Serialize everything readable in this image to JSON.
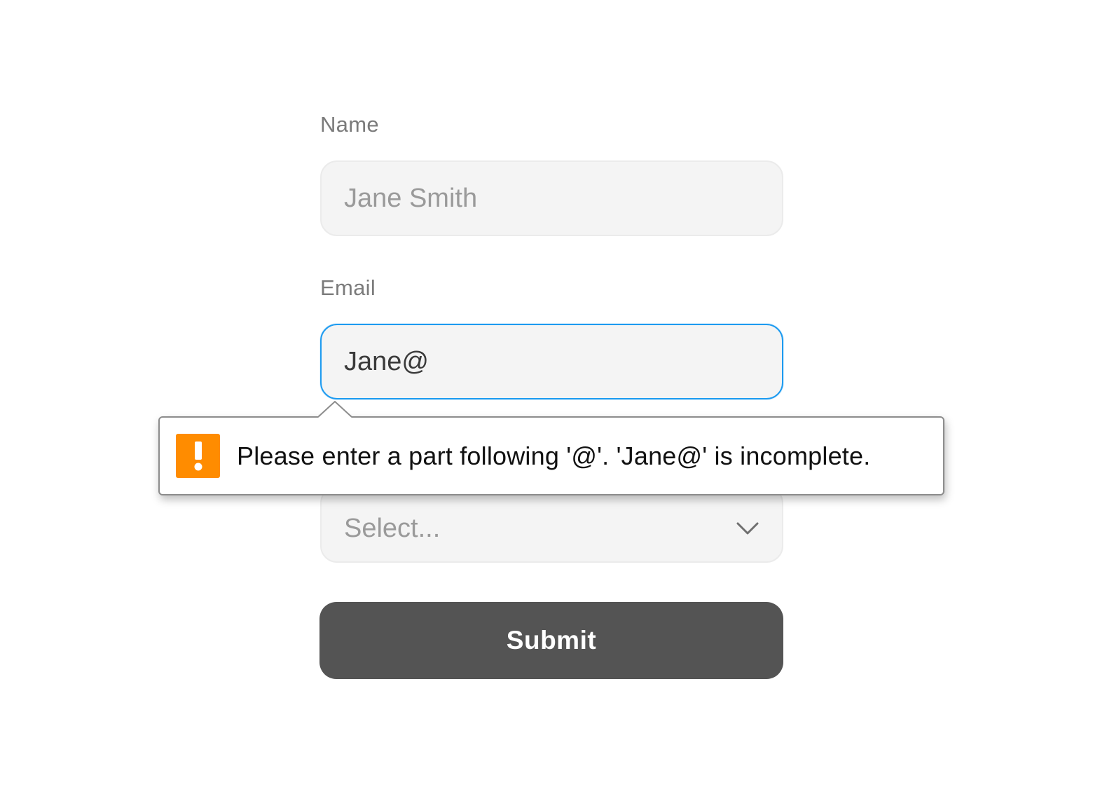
{
  "form": {
    "name_label": "Name",
    "name_placeholder": "Jane Smith",
    "name_value": "",
    "email_label": "Email",
    "email_value": "Jane@",
    "select_placeholder": "Select...",
    "submit_label": "Submit"
  },
  "validation": {
    "message": "Please enter a part following '@'. 'Jane@' is incomplete.",
    "icon": "warning-icon",
    "icon_color": "#ff8c00"
  },
  "colors": {
    "focus_border": "#1e9bf0",
    "button_bg": "#545454"
  }
}
